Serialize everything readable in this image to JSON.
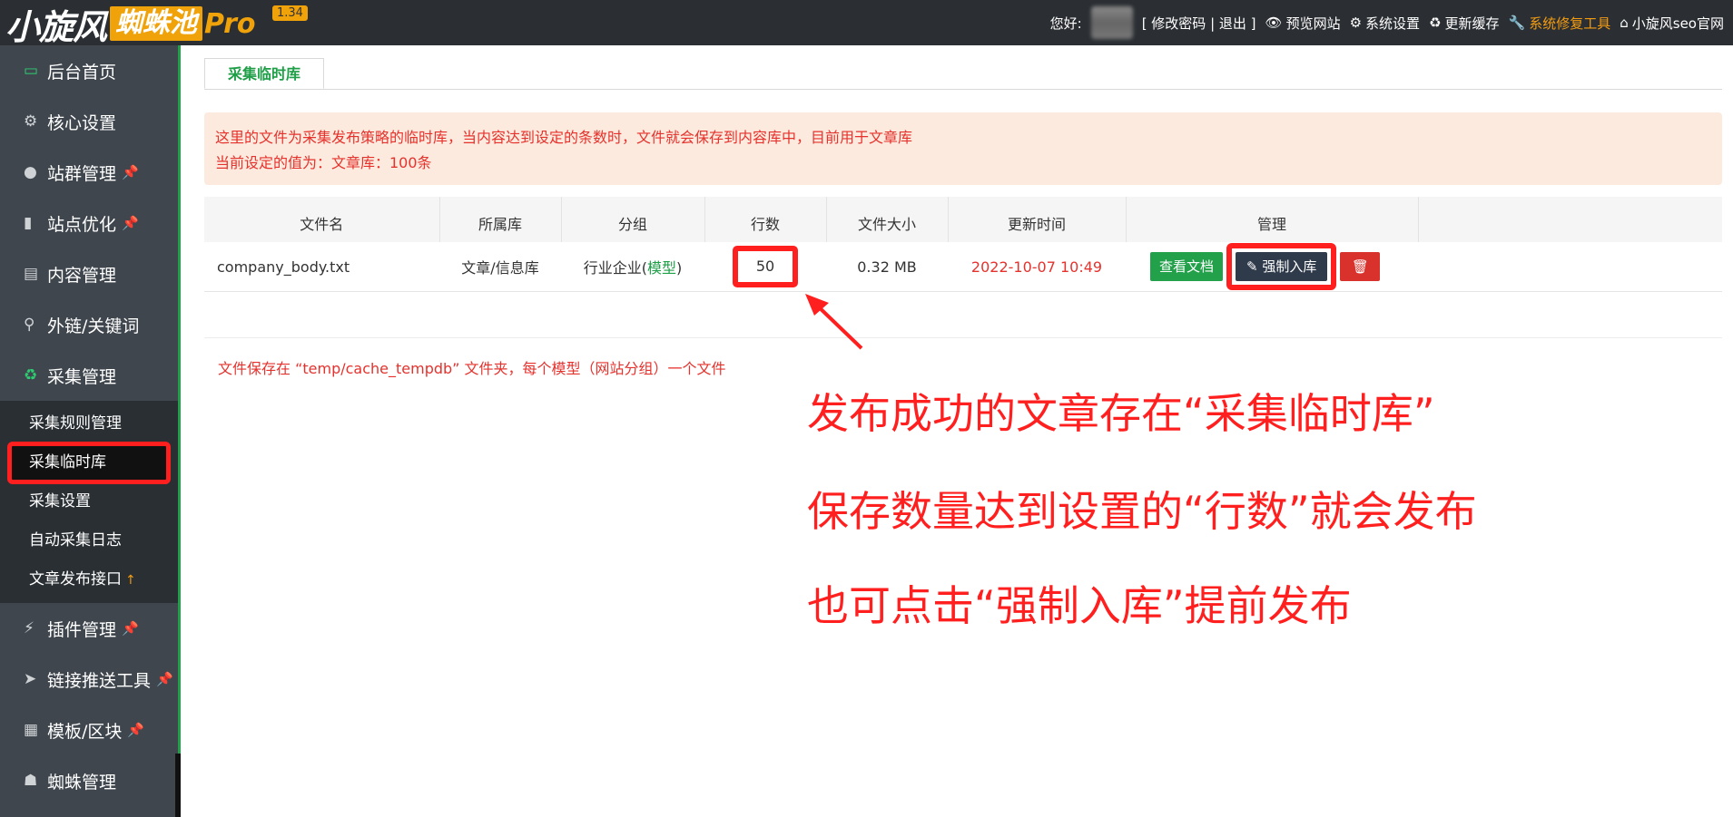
{
  "header": {
    "logo_main": "小旋风",
    "logo_sub": "蜘蛛池",
    "logo_pro": "Pro",
    "version": "1.34",
    "greeting": "您好:",
    "account_links": "[ 修改密码 | 退出 ]",
    "links": [
      {
        "label": "预览网站",
        "icon": "eye-icon"
      },
      {
        "label": "系统设置",
        "icon": "gear-icon"
      },
      {
        "label": "更新缓存",
        "icon": "refresh-icon"
      },
      {
        "label": "系统修复工具",
        "icon": "wrench-icon"
      },
      {
        "label": "小旋风seo官网",
        "icon": "home-icon"
      }
    ]
  },
  "sidebar": {
    "items": [
      {
        "label": "后台首页",
        "icon": "monitor-icon"
      },
      {
        "label": "核心设置",
        "icon": "gear-icon"
      },
      {
        "label": "站群管理",
        "icon": "user-icon",
        "pinned": true
      },
      {
        "label": "站点优化",
        "icon": "bar-chart-icon",
        "pinned": true
      },
      {
        "label": "内容管理",
        "icon": "document-icon"
      },
      {
        "label": "外链/关键词",
        "icon": "link-icon"
      },
      {
        "label": "采集管理",
        "icon": "recycle-icon"
      }
    ],
    "subitems": [
      {
        "label": "采集规则管理"
      },
      {
        "label": "采集临时库"
      },
      {
        "label": "采集设置"
      },
      {
        "label": "自动采集日志"
      },
      {
        "label": "文章发布接口"
      }
    ],
    "items_after": [
      {
        "label": "插件管理",
        "icon": "plug-icon",
        "pinned": true
      },
      {
        "label": "链接推送工具",
        "icon": "send-icon",
        "pinned": true
      },
      {
        "label": "模板/区块",
        "icon": "template-icon",
        "pinned": true
      },
      {
        "label": "蜘蛛管理",
        "icon": "android-icon"
      }
    ]
  },
  "main": {
    "tab": "采集临时库",
    "notice_line1": "这里的文件为采集发布策略的临时库，当内容达到设定的条数时，文件就会保存到内容库中，目前用于文章库",
    "notice_line2": "当前设定的值为：文章库：100条",
    "table": {
      "headers": [
        "文件名",
        "所属库",
        "分组",
        "行数",
        "文件大小",
        "更新时间",
        "管理"
      ],
      "row": {
        "filename": "company_body.txt",
        "library": "文章/信息库",
        "group_name": "行业企业(",
        "group_link": "模型",
        "group_close": ")",
        "lines": "50",
        "size": "0.32 MB",
        "updated": "2022-10-07 10:49",
        "view_btn": "查看文档",
        "force_btn": "强制入库"
      }
    },
    "note": "文件保存在 “temp/cache_tempdb” 文件夹，每个模型（网站分组）一个文件",
    "annotations": [
      "发布成功的文章存在“采集临时库”",
      "保存数量达到设置的“行数”就会发布",
      "也可点击“强制入库”提前发布"
    ]
  },
  "colors": {
    "topbar": "#2b2f33",
    "sidebar": "#3f464e",
    "accent_green": "#22a04a",
    "orange": "#f39c12",
    "highlight_red": "#ff1f1f"
  }
}
